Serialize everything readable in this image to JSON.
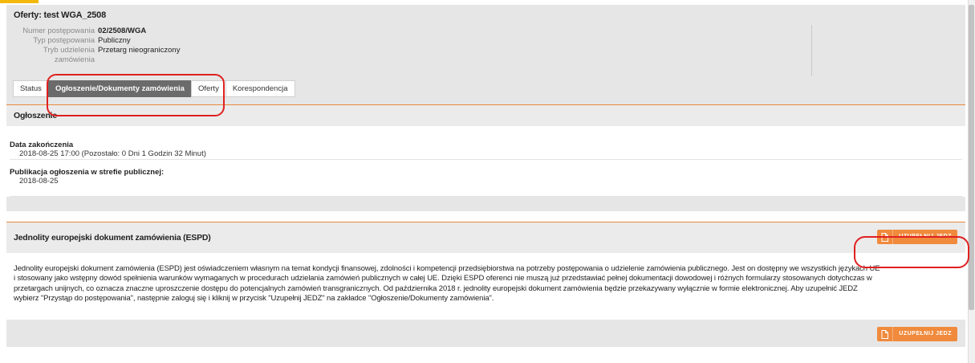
{
  "header": {
    "title": "Oferty: test WGA_2508"
  },
  "meta": [
    {
      "label": "Numer postępowania",
      "value": "02/2508/WGA"
    },
    {
      "label": "Typ postępowania",
      "value": "Publiczny"
    },
    {
      "label": "Tryb udzielenia",
      "value": "Przetarg nieograniczony"
    },
    {
      "label": "zamówienia",
      "value": ""
    }
  ],
  "tabs": [
    {
      "label": "Status",
      "active": false
    },
    {
      "label": "Ogłoszenie/Dokumenty zamówienia",
      "active": true
    },
    {
      "label": "Oferty",
      "active": false
    },
    {
      "label": "Korespondencja",
      "active": false
    }
  ],
  "ogloszenie": {
    "title": "Ogłoszenie",
    "fields": [
      {
        "label": "Data zakończenia",
        "value": "2018-08-25 17:00 (Pozostało: 0 Dni 1 Godzin 32 Minut)"
      },
      {
        "label": "Publikacja ogłoszenia w strefie publicznej:",
        "value": "2018-08-25"
      }
    ]
  },
  "espd": {
    "title": "Jednolity europejski dokument zamówienia (ESPD)",
    "button_label": "UZUPEŁNIJ JEDZ",
    "button_icon": "document-icon",
    "description_lines": [
      "Jednolity europejski dokument zamówienia (ESPD) jest oświadczeniem własnym na temat kondycji finansowej, zdolności i kompetencji przedsiębiorstwa na potrzeby postępowania o udzielenie zamówienia publicznego. Jest on dostępny we wszystkich językach UE",
      "i stosowany jako wstępny dowód spełnienia warunków wymaganych w procedurach udzielania zamówień publicznych w całej UE. Dzięki ESPD oferenci nie muszą już przedstawiać pełnej dokumentacji dowodowej i różnych formularzy stosowanych dotychczas w",
      "przetargach unijnych, co oznacza znaczne uproszczenie dostępu do potencjalnych zamówień transgranicznych. Od października 2018 r. jednolity europejski dokument zamówienia będzie przekazywany wyłącznie w formie elektronicznej. Aby uzupełnić JEDZ",
      "wybierz \"Przystąp do postępowania\", następnie zaloguj się i kliknij w przycisk \"Uzupełnij JEDZ\" na zakładce \"Ogłoszenie/Dokumenty zamówienia\"."
    ]
  },
  "colors": {
    "accent_orange": "#f08a3c",
    "annotation_red": "#e02020",
    "active_tab": "#6b6b6b"
  }
}
